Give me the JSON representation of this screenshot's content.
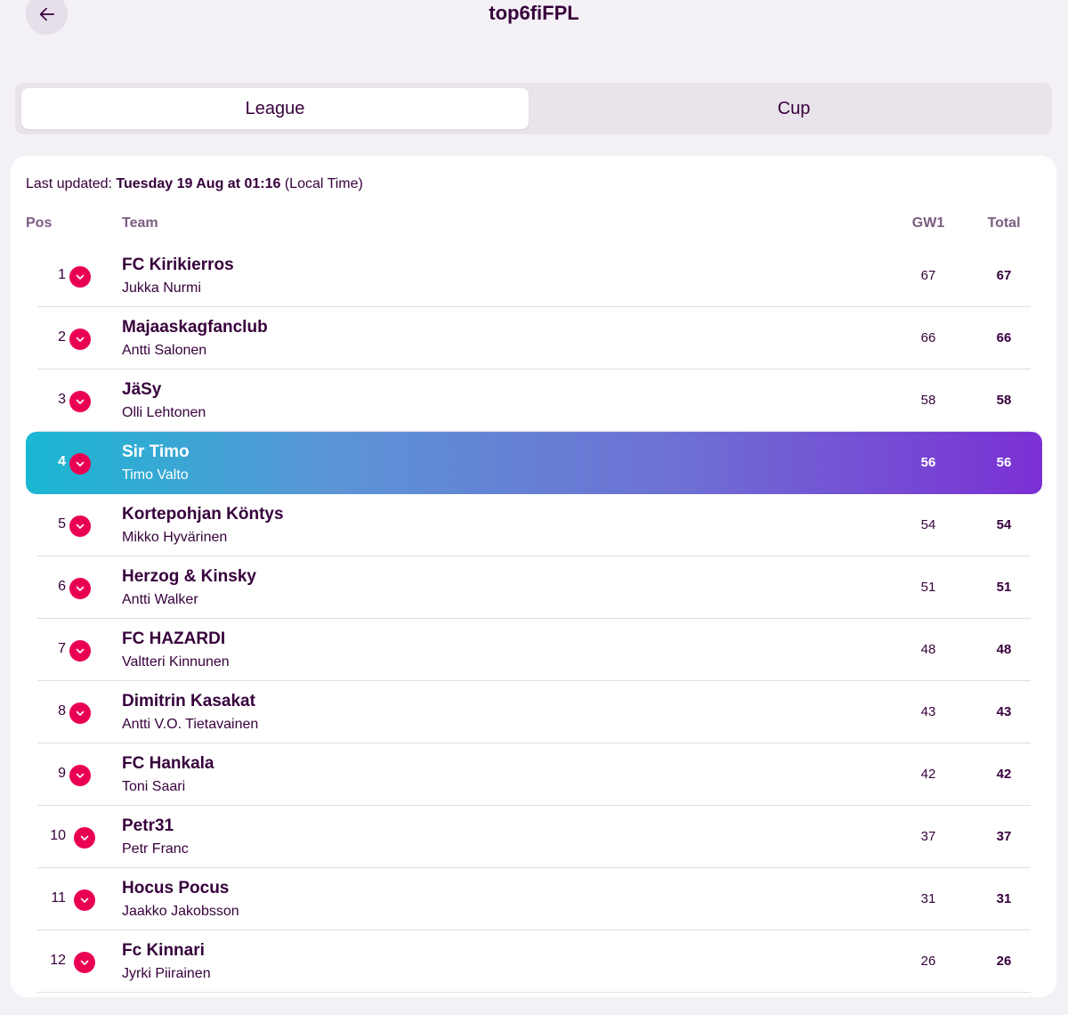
{
  "header": {
    "title": "top6fiFPL",
    "back_icon": "arrow-left-icon"
  },
  "tabs": [
    {
      "label": "League",
      "active": true
    },
    {
      "label": "Cup",
      "active": false
    }
  ],
  "updated": {
    "prefix": "Last updated: ",
    "datetime": "Tuesday 19 Aug at 01:16",
    "suffix": " (Local Time)"
  },
  "columns": {
    "pos": "Pos",
    "team": "Team",
    "gw": "GW1",
    "total": "Total"
  },
  "colors": {
    "brand": "#37003c",
    "movement_down": "#e90052",
    "highlight_start": "#19b7d2",
    "highlight_end": "#7b30d4"
  },
  "standings": [
    {
      "pos": "1",
      "team": "FC Kirikierros",
      "manager": "Jukka Nurmi",
      "gw": "67",
      "total": "67",
      "movement": "down",
      "highlight": false
    },
    {
      "pos": "2",
      "team": "Majaaskagfanclub",
      "manager": "Antti Salonen",
      "gw": "66",
      "total": "66",
      "movement": "down",
      "highlight": false
    },
    {
      "pos": "3",
      "team": "JäSy",
      "manager": "Olli Lehtonen",
      "gw": "58",
      "total": "58",
      "movement": "down",
      "highlight": false
    },
    {
      "pos": "4",
      "team": "Sir Timo",
      "manager": "Timo Valto",
      "gw": "56",
      "total": "56",
      "movement": "down",
      "highlight": true
    },
    {
      "pos": "5",
      "team": "Kortepohjan Köntys",
      "manager": "Mikko Hyvärinen",
      "gw": "54",
      "total": "54",
      "movement": "down",
      "highlight": false
    },
    {
      "pos": "6",
      "team": "Herzog & Kinsky",
      "manager": "Antti Walker",
      "gw": "51",
      "total": "51",
      "movement": "down",
      "highlight": false
    },
    {
      "pos": "7",
      "team": "FC HAZARDI",
      "manager": "Valtteri Kinnunen",
      "gw": "48",
      "total": "48",
      "movement": "down",
      "highlight": false
    },
    {
      "pos": "8",
      "team": "Dimitrin Kasakat",
      "manager": "Antti V.O. Tietavainen",
      "gw": "43",
      "total": "43",
      "movement": "down",
      "highlight": false
    },
    {
      "pos": "9",
      "team": "FC Hankala",
      "manager": "Toni Saari",
      "gw": "42",
      "total": "42",
      "movement": "down",
      "highlight": false
    },
    {
      "pos": "10",
      "team": "Petr31",
      "manager": "Petr Franc",
      "gw": "37",
      "total": "37",
      "movement": "down",
      "highlight": false
    },
    {
      "pos": "11",
      "team": "Hocus Pocus",
      "manager": "Jaakko Jakobsson",
      "gw": "31",
      "total": "31",
      "movement": "down",
      "highlight": false
    },
    {
      "pos": "12",
      "team": "Fc Kinnari",
      "manager": "Jyrki Piirainen",
      "gw": "26",
      "total": "26",
      "movement": "down",
      "highlight": false
    }
  ]
}
